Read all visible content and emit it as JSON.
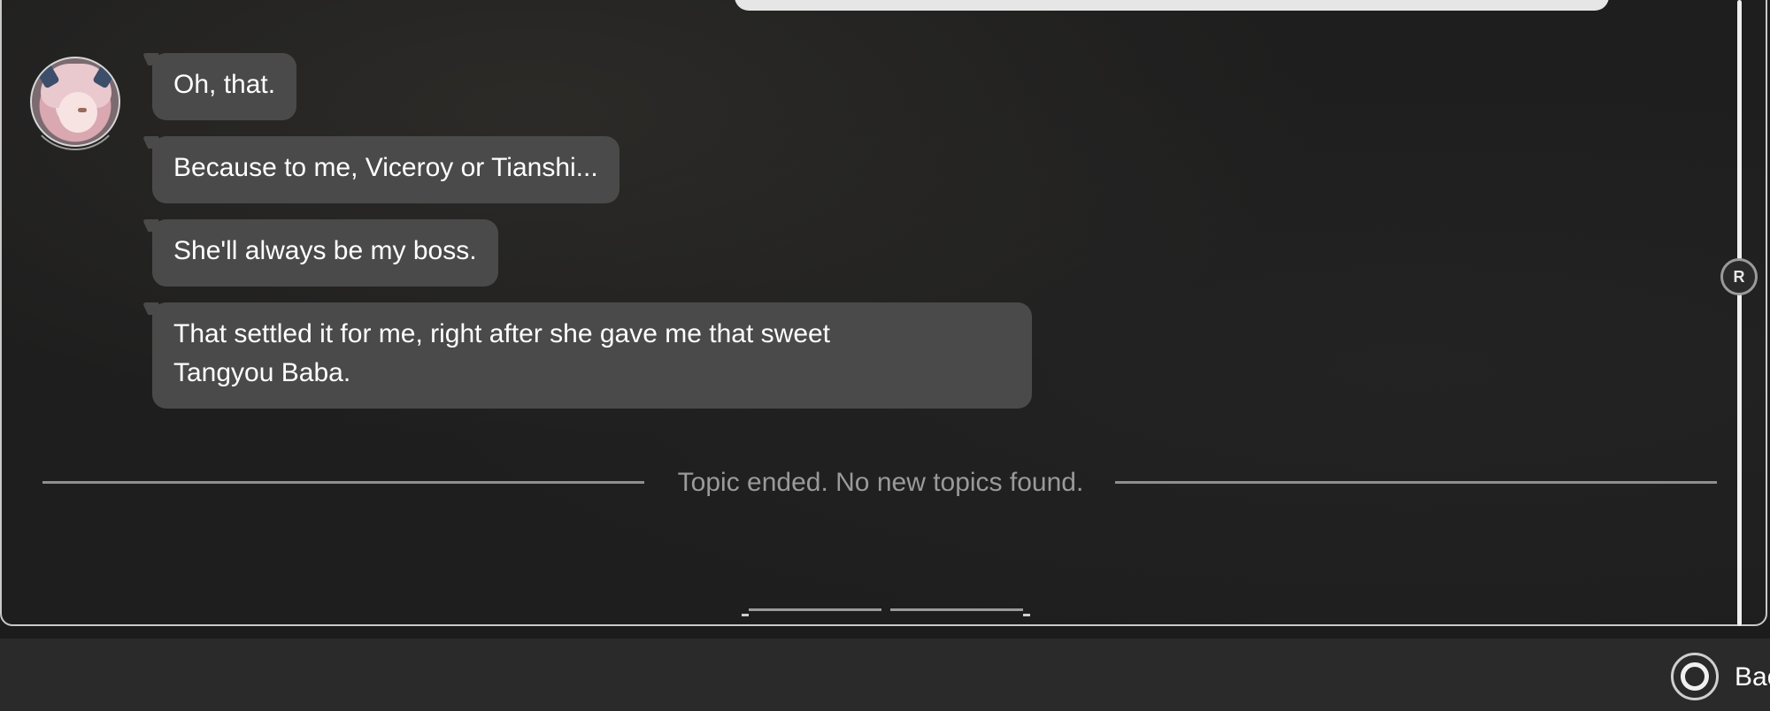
{
  "messages": [
    {
      "text": "Oh, that."
    },
    {
      "text": "Because to me, Viceroy or Tianshi..."
    },
    {
      "text": "She'll always be my boss."
    },
    {
      "text": "That settled it for me, right after she gave me that sweet\nTangyou Baba."
    }
  ],
  "status": {
    "topic_ended": "Topic ended. No new topics found."
  },
  "scrollbar": {
    "handle_label": "R"
  },
  "bottom_bar": {
    "back_label": "Bac"
  },
  "icons": {
    "avatar": "character-avatar",
    "back": "circle-button-icon"
  }
}
